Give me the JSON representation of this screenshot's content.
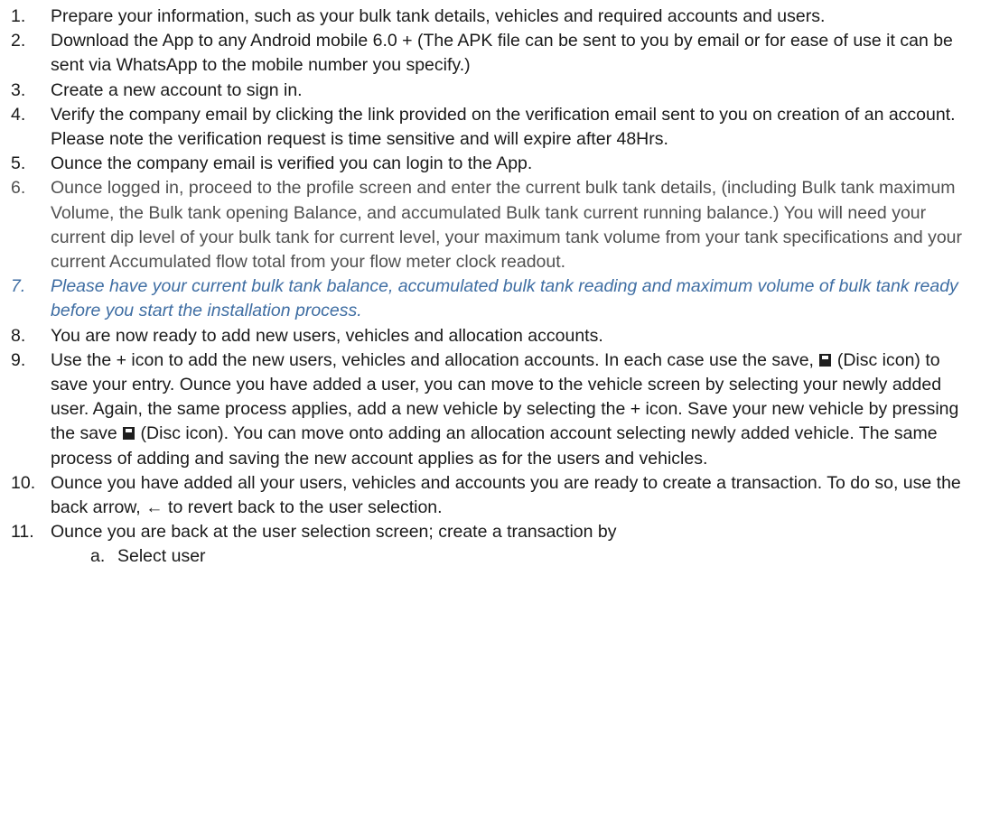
{
  "items": [
    {
      "num": "1.",
      "text": "Prepare your information, such as your bulk tank details, vehicles and required accounts and users."
    },
    {
      "num": "2.",
      "text": "Download the App to any Android mobile 6.0 +  (The APK file can be sent to you by email or for ease of use it can be sent via WhatsApp to the mobile number you specify.)"
    },
    {
      "num": "3.",
      "text": "Create a new account to sign in."
    },
    {
      "num": "4.",
      "text": "Verify the company email by clicking the link provided on the verification email sent to you on creation of an account. Please note the verification request is time sensitive and will expire after 48Hrs."
    },
    {
      "num": "5.",
      "text": "Ounce the company email is verified you can login to the App."
    },
    {
      "num": "6.",
      "text_a": "Ounce logged in, proceed to the profile screen and enter the current bulk tank details, (including Bulk tank maximum Volume, the Bulk tank opening Balance, and accumulated Bulk tank current running balance.)",
      "text_b": " You will need your current dip level of your bulk tank for current level, your maximum tank volume from your tank specifications and your current Accumulated flow total from your flow meter clock readout."
    },
    {
      "num": "7.",
      "text": "Please have your current bulk tank balance, accumulated bulk tank reading and maximum volume of bulk tank ready before you start the installation process."
    },
    {
      "num": "8.",
      "text": "You are now ready to add new users, vehicles and allocation accounts."
    },
    {
      "num": "9.",
      "text_a": "Use the + icon to add the new users, vehicles and allocation accounts. In each case use the save, ",
      "text_b": " (Disc icon) to save your entry. Ounce you have added a user, you can move to the vehicle screen by selecting your newly added user. Again, the same process applies, add a new vehicle by selecting the + icon. Save your new vehicle by pressing the save ",
      "text_c": " (Disc icon). You can move onto adding an allocation account selecting newly added vehicle. The same process of adding and saving the new account applies as for the users and vehicles."
    },
    {
      "num": "10.",
      "text_a": "Ounce you have added all your users, vehicles and accounts you are ready to create a transaction. To do so, use the back arrow, ",
      "arrow": "←",
      "text_b": " to revert back to the user selection."
    },
    {
      "num": "11.",
      "text": "Ounce you are back at the user selection screen; create a transaction by"
    }
  ],
  "subitems": [
    {
      "num": "a.",
      "text": "Select user"
    }
  ]
}
